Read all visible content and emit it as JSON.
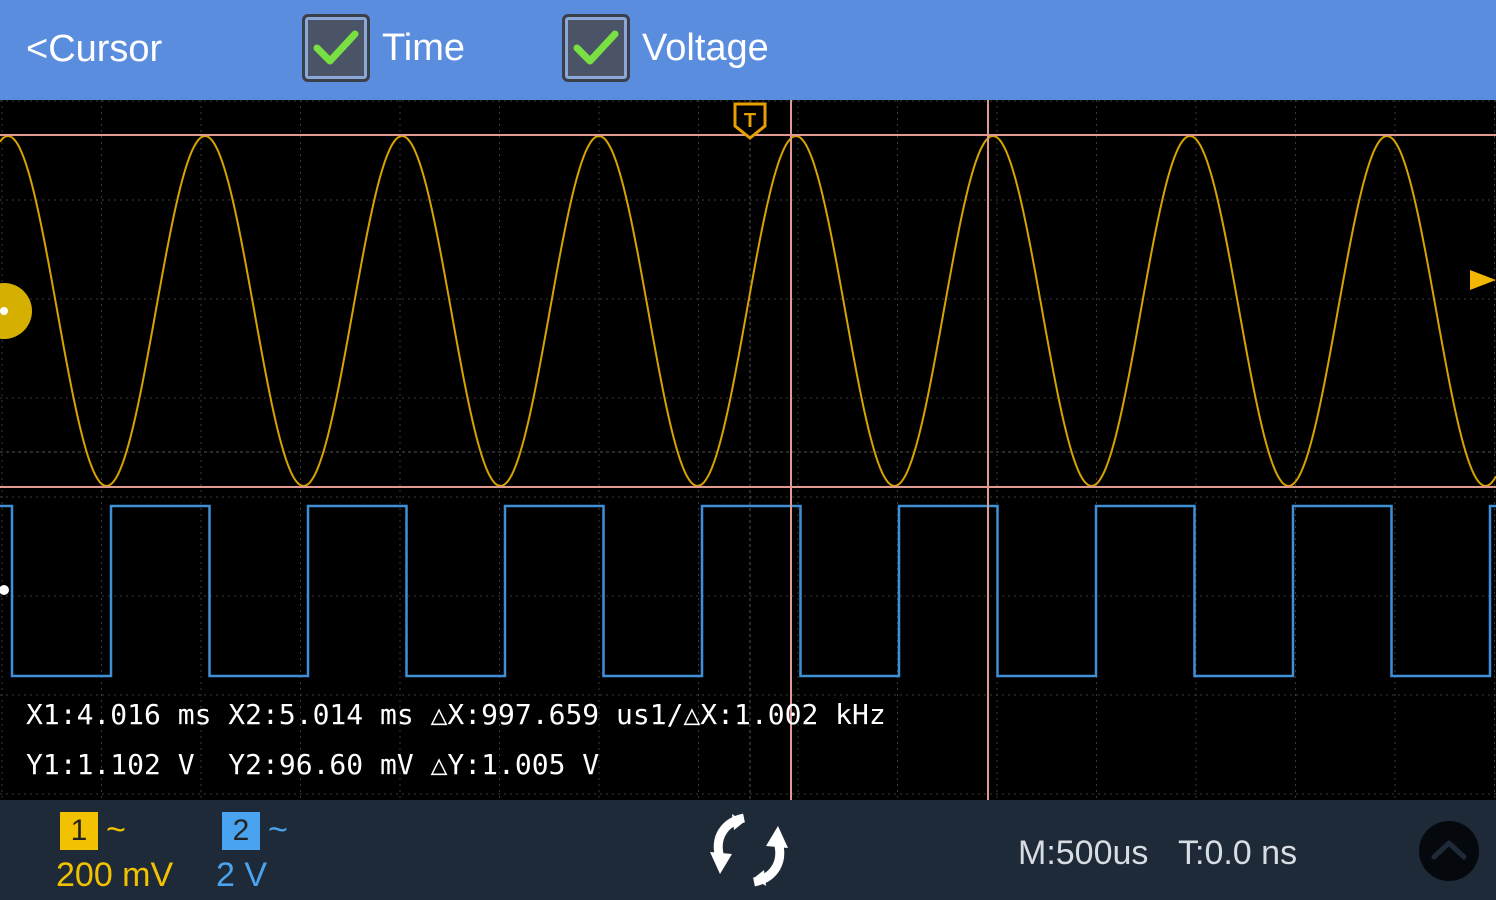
{
  "header": {
    "back_label": "<Cursor",
    "time_label": "Time",
    "voltage_label": "Voltage",
    "time_checked": true,
    "voltage_checked": true
  },
  "trigger_marker": "T",
  "readout": {
    "line1": "X1:4.016 ms X2:5.014 ms △X:997.659 us1/△X:1.002 kHz",
    "line2": "Y1:1.102 V  Y2:96.60 mV △Y:1.005 V"
  },
  "channels": [
    {
      "number": "1",
      "coupling_symbol": "~",
      "scale": "200 mV",
      "color": "#e8b400"
    },
    {
      "number": "2",
      "coupling_symbol": "~",
      "scale": "2 V",
      "color": "#3f9be6"
    }
  ],
  "timebase": {
    "main": "M:500us",
    "trigger_offset": "T:0.0 ns"
  },
  "colors": {
    "header": "#5b8ddf",
    "grid": "#4a4a4a",
    "cursor": "#e09a90",
    "ch1": "#d6a300",
    "ch2": "#3f8fd6"
  }
}
